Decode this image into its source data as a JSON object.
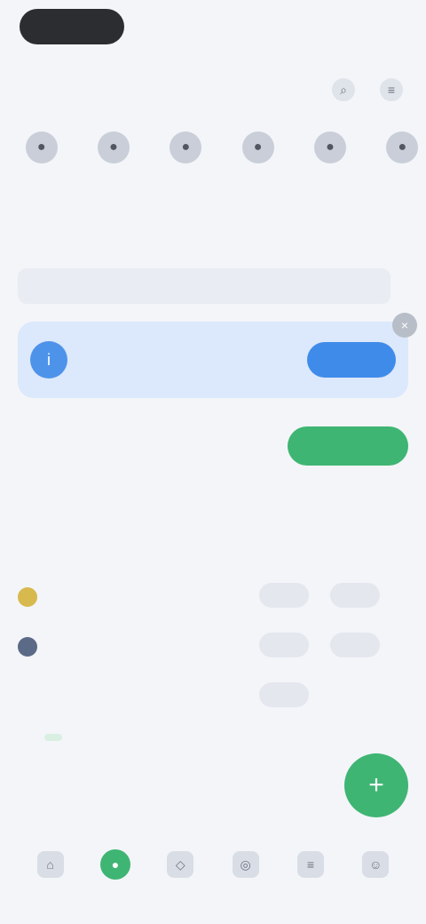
{
  "header": {
    "pill_label": "",
    "right_label": ""
  },
  "section": {
    "title": "",
    "icons": [
      "search-icon",
      "menu-icon"
    ]
  },
  "chips": [
    {
      "label": "",
      "icon": "●"
    },
    {
      "label": "",
      "icon": "●"
    },
    {
      "label": "",
      "icon": "●"
    },
    {
      "label": "",
      "icon": "●"
    },
    {
      "label": "",
      "icon": "●"
    },
    {
      "label": "",
      "icon": "●"
    }
  ],
  "stats": {
    "left": "",
    "right": ""
  },
  "search": {
    "placeholder": ""
  },
  "banner": {
    "text": "",
    "button_label": "",
    "close_icon": "×"
  },
  "promo": {
    "title": "",
    "subtitle": "",
    "button_label": ""
  },
  "list": {
    "title": "",
    "more": "",
    "columns": [
      "",
      "",
      "",
      ""
    ],
    "rows": [
      {
        "name": "",
        "col2": "",
        "col3": "",
        "col4": "",
        "color": "#d7b94d"
      },
      {
        "name": "",
        "col2": "",
        "col3": "",
        "col4": "",
        "color": "#5b6a86"
      },
      {
        "name": "",
        "col2": "",
        "col3": "",
        "col4": "",
        "color": "#c9ced8"
      }
    ]
  },
  "footer": {
    "text": "",
    "badge": ""
  },
  "fab": {
    "icon": "+"
  },
  "hints": [
    "",
    "",
    ""
  ],
  "nav": [
    {
      "label": "",
      "icon": "⌂",
      "active": false
    },
    {
      "label": "",
      "icon": "●",
      "active": true
    },
    {
      "label": "",
      "icon": "◇",
      "active": false
    },
    {
      "label": "",
      "icon": "◎",
      "active": false
    },
    {
      "label": "",
      "icon": "≡",
      "active": false
    },
    {
      "label": "",
      "icon": "☺",
      "active": false
    }
  ],
  "colors": {
    "accent_green": "#3fb573",
    "accent_blue": "#3f8bea",
    "background": "#f3f5f9"
  }
}
